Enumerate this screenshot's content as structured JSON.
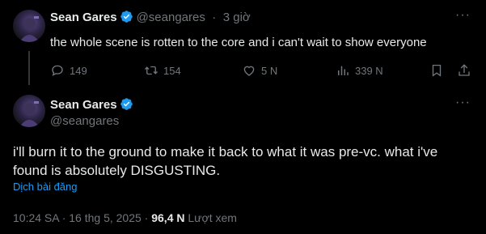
{
  "reply_tweet": {
    "author_name": "Sean Gares",
    "handle": "@seangares",
    "separator": "·",
    "time": "3 giờ",
    "text": "the whole scene is rotten to the core and i can't wait to show everyone",
    "more_label": "···",
    "actions": {
      "replies": "149",
      "retweets": "154",
      "likes": "5 N",
      "views": "339 N"
    }
  },
  "main_tweet": {
    "author_name": "Sean Gares",
    "handle": "@seangares",
    "more_label": "···",
    "text": "i'll burn it to the ground to make it back to what it was pre-vc.  what i've found is absolutely DISGUSTING.",
    "translate_label": "Dịch bài đăng",
    "timestamp": "10:24 SA · 16 thg 5, 2025 ·",
    "views_count": "96,4 N",
    "views_label": "Lượt xem"
  },
  "colors": {
    "background": "#000000",
    "text_primary": "#e7e9ea",
    "text_secondary": "#71767b",
    "accent": "#1d9bf0",
    "divider": "#2f3336"
  }
}
